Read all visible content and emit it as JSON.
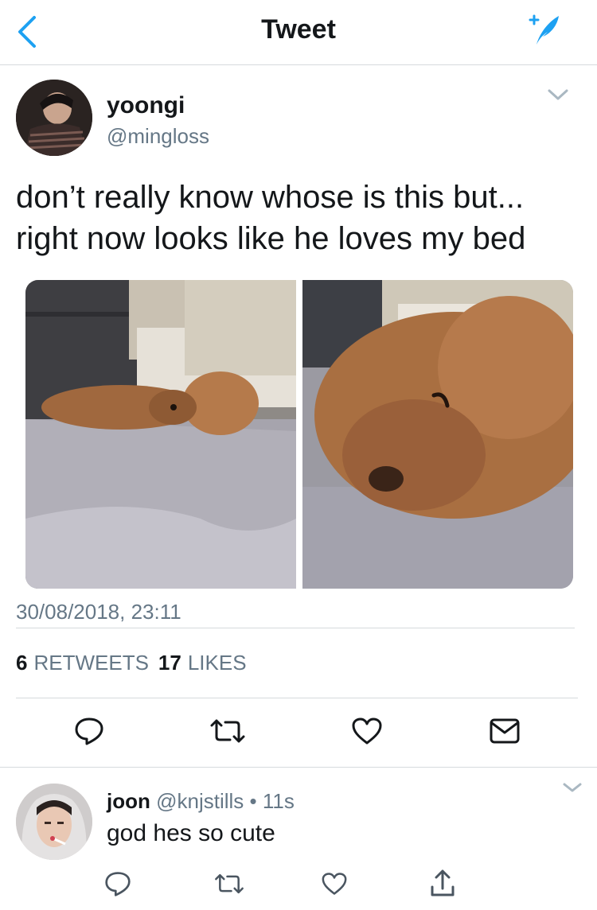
{
  "nav": {
    "title": "Tweet",
    "back_icon": "chevron-left-icon",
    "compose_icon": "compose-tweet-icon",
    "accent": "#1da1f2"
  },
  "tweet": {
    "author": {
      "name": "yoongi",
      "handle": "@mingloss"
    },
    "text": "don’t really know whose is this but... right now looks like he loves my bed",
    "timestamp": "30/08/2018, 23:11",
    "stats": {
      "retweets_count": "6",
      "retweets_label": "RETWEETS",
      "likes_count": "17",
      "likes_label": "LIKES"
    },
    "actions": [
      "reply-icon",
      "retweet-icon",
      "like-icon",
      "direct-message-icon"
    ]
  },
  "reply": {
    "author": {
      "name": "joon",
      "handle": "@knjstills"
    },
    "separator": "•",
    "time": "11s",
    "text": "god hes so cute",
    "actions": [
      "reply-icon",
      "retweet-icon",
      "like-icon",
      "share-icon"
    ]
  },
  "colors": {
    "text": "#14171a",
    "secondary": "#657786",
    "divider": "#d6dadd",
    "accent": "#1da1f2"
  }
}
